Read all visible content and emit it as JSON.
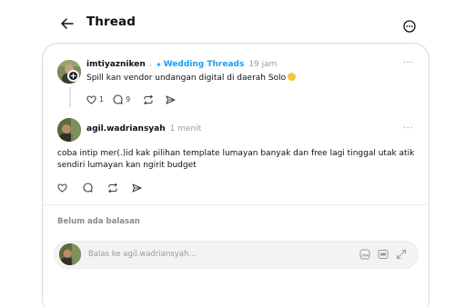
{
  "header": {
    "title": "Thread",
    "back_icon": "arrow-left-icon",
    "more_icon": "more-circle-icon"
  },
  "original_post": {
    "username": "imtiyazniken",
    "community": "Wedding Threads",
    "community_icon": "threads-community-icon",
    "time": "19 jam",
    "text": "Spill kan vendor undangan digital di daerah Solo",
    "emoji": "smiling-face-emoji",
    "like_count": "1",
    "comment_count": "9"
  },
  "reply": {
    "username": "agil.wadriansyah",
    "time": "1 menit",
    "text": "coba intip mer(.)id kak pilihan template lumayan banyak dan free lagi tinggal utak atik sendiri lumayan kan ngirit budget"
  },
  "replies_status": "Belum ada balasan",
  "composer": {
    "placeholder": "Balas ke agil.wadriansyah...",
    "icons": [
      "image-icon",
      "gif-icon",
      "expand-icon"
    ]
  },
  "colors": {
    "community_blue": "#1d9bf0",
    "text": "#101010",
    "muted": "#9a9a9a"
  }
}
